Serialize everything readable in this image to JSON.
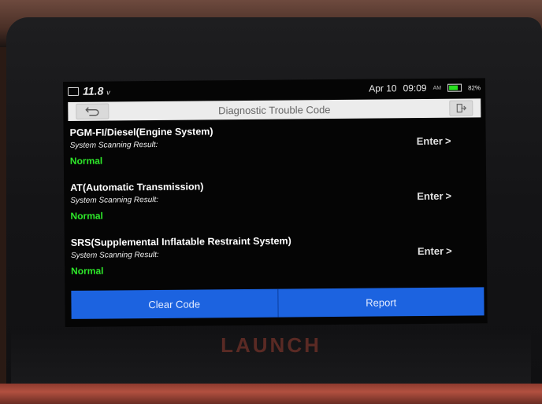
{
  "device": {
    "brand": "LAUNCH"
  },
  "status_bar": {
    "voltage": "11.8",
    "voltage_unit": "v",
    "date": "Apr 10",
    "time": "09:09",
    "time_suffix": "AM",
    "battery": "82%",
    "battery_level": 0.82,
    "battery_color": "#28e020"
  },
  "title_bar": {
    "title": "Diagnostic Trouble Code"
  },
  "systems": [
    {
      "name": "PGM-FI/Diesel(Engine System)",
      "label": "System Scanning Result:",
      "result": "Normal",
      "enter": "Enter"
    },
    {
      "name": "AT(Automatic Transmission)",
      "label": "System Scanning Result:",
      "result": "Normal",
      "enter": "Enter"
    },
    {
      "name": "SRS(Supplemental Inflatable Restraint System)",
      "label": "System Scanning Result:",
      "result": "Normal",
      "enter": "Enter"
    }
  ],
  "bottom_bar": {
    "clear_label": "Clear Code",
    "report_label": "Report",
    "color": "#1c63e0"
  }
}
